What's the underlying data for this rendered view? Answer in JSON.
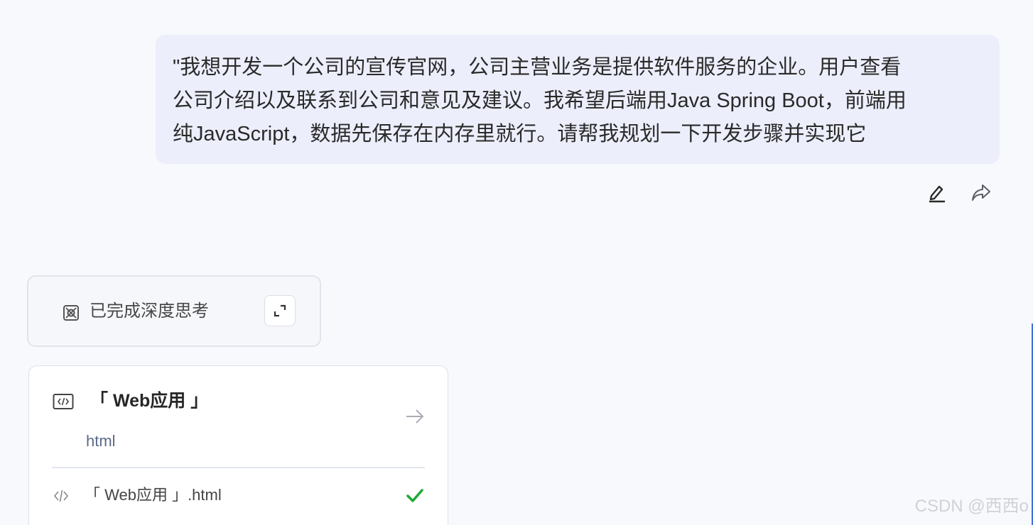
{
  "user_message": {
    "lines": [
      "\"我想开发一个公司的宣传官网，公司主营业务是提供软件服务的企业。用户查看",
      "公司介绍以及联系到公司和意见及建议。我希望后端用Java Spring Boot，前端用",
      "纯JavaScript，数据先保存在内存里就行。请帮我规划一下开发步骤并实现它"
    ]
  },
  "message_actions": {
    "icons": [
      "edit-icon",
      "share-icon"
    ]
  },
  "thinking": {
    "label": "已完成深度思考",
    "icon": "brain-icon",
    "expand_icon": "expand-icon"
  },
  "web_card": {
    "title": "「 Web应用 」",
    "language": "html",
    "file_name": "「 Web应用 」.html",
    "status": "done",
    "status_color": "#22a83a"
  },
  "watermark": "CSDN @西西o"
}
